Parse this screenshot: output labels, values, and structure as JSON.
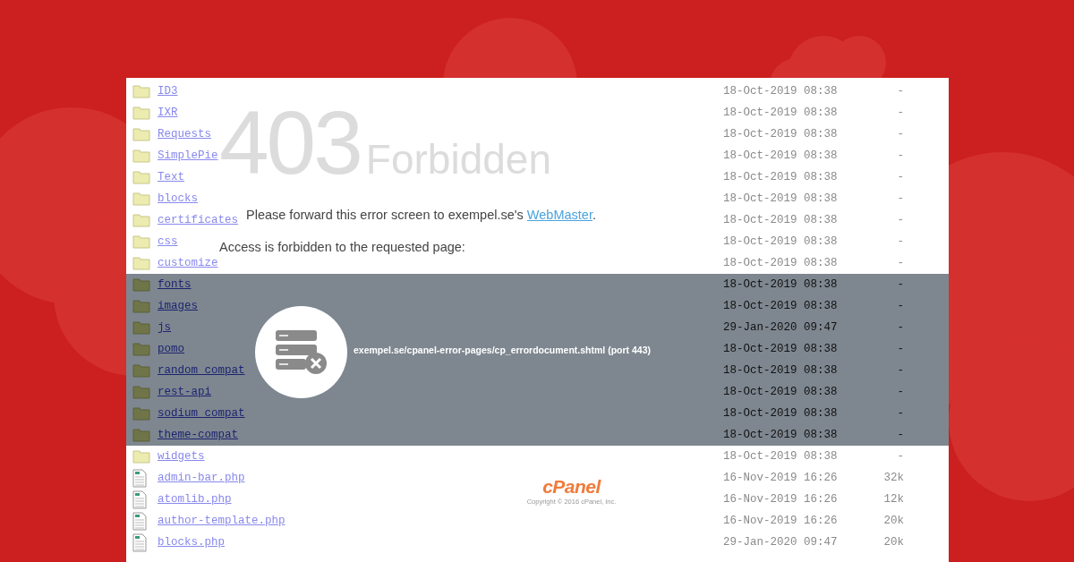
{
  "error": {
    "code": "403",
    "title": "Forbidden",
    "message": "Please forward this error screen to exempel.se's ",
    "link": "WebMaster",
    "message_end": ".",
    "detail": "Access is forbidden to the requested page:",
    "url": "exempel.se/cpanel-error-pages/cp_errordocument.shtml (port 443)"
  },
  "listing": [
    {
      "kind": "folder",
      "name": "ID3",
      "modified": "18-Oct-2019 08:38",
      "size": "-"
    },
    {
      "kind": "folder",
      "name": "IXR",
      "modified": "18-Oct-2019 08:38",
      "size": "-"
    },
    {
      "kind": "folder",
      "name": "Requests",
      "modified": "18-Oct-2019 08:38",
      "size": "-"
    },
    {
      "kind": "folder",
      "name": "SimplePie",
      "modified": "18-Oct-2019 08:38",
      "size": "-"
    },
    {
      "kind": "folder",
      "name": "Text",
      "modified": "18-Oct-2019 08:38",
      "size": "-"
    },
    {
      "kind": "folder",
      "name": "blocks",
      "modified": "18-Oct-2019 08:38",
      "size": "-"
    },
    {
      "kind": "folder",
      "name": "certificates",
      "modified": "18-Oct-2019 08:38",
      "size": "-"
    },
    {
      "kind": "folder",
      "name": "css",
      "modified": "18-Oct-2019 08:38",
      "size": "-"
    },
    {
      "kind": "folder",
      "name": "customize",
      "modified": "18-Oct-2019 08:38",
      "size": "-"
    },
    {
      "kind": "folder",
      "name": "fonts",
      "modified": "18-Oct-2019 08:38",
      "size": "-",
      "shaded": true
    },
    {
      "kind": "folder",
      "name": "images",
      "modified": "18-Oct-2019 08:38",
      "size": "-",
      "shaded": true
    },
    {
      "kind": "folder",
      "name": "js",
      "modified": "29-Jan-2020 09:47",
      "size": "-",
      "shaded": true
    },
    {
      "kind": "folder",
      "name": "pomo",
      "modified": "18-Oct-2019 08:38",
      "size": "-",
      "shaded": true
    },
    {
      "kind": "folder",
      "name": "random_compat",
      "modified": "18-Oct-2019 08:38",
      "size": "-",
      "shaded": true
    },
    {
      "kind": "folder",
      "name": "rest-api",
      "modified": "18-Oct-2019 08:38",
      "size": "-",
      "shaded": true
    },
    {
      "kind": "folder",
      "name": "sodium_compat",
      "modified": "18-Oct-2019 08:38",
      "size": "-",
      "shaded": true
    },
    {
      "kind": "folder",
      "name": "theme-compat",
      "modified": "18-Oct-2019 08:38",
      "size": "-",
      "shaded": true
    },
    {
      "kind": "folder",
      "name": "widgets",
      "modified": "18-Oct-2019 08:38",
      "size": "-"
    },
    {
      "kind": "file",
      "name": "admin-bar.php",
      "modified": "16-Nov-2019 16:26",
      "size": "32k"
    },
    {
      "kind": "file",
      "name": "atomlib.php",
      "modified": "16-Nov-2019 16:26",
      "size": "12k"
    },
    {
      "kind": "file",
      "name": "author-template.php",
      "modified": "16-Nov-2019 16:26",
      "size": "20k"
    },
    {
      "kind": "file",
      "name": "blocks.php",
      "modified": "29-Jan-2020 09:47",
      "size": "20k"
    }
  ],
  "footer": {
    "logo": "cPanel",
    "copyright": "Copyright © 2016 cPanel, Inc."
  }
}
